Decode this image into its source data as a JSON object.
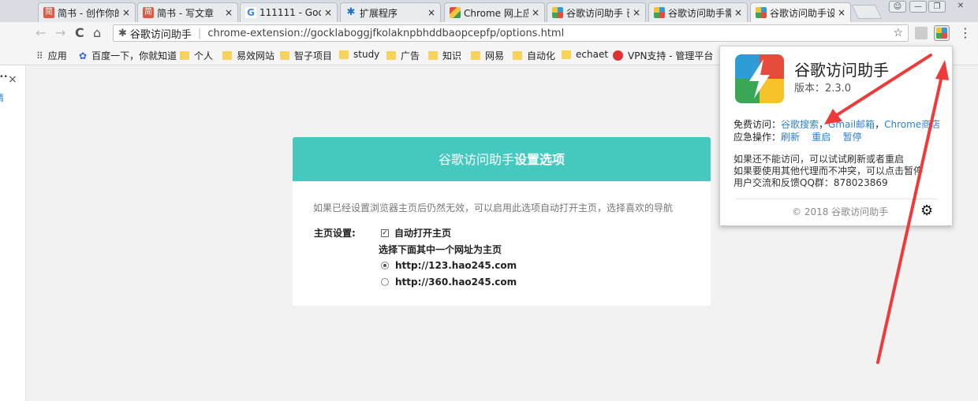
{
  "window": {
    "tabs": [
      {
        "label": "简书 - 创作你的",
        "icon": "jianshu-icon",
        "close": "×"
      },
      {
        "label": "简书 - 写文章",
        "icon": "jianshu-icon",
        "close": "×"
      },
      {
        "label": "111111 - Goog",
        "icon": "google-icon",
        "close": "×"
      },
      {
        "label": "扩展程序",
        "icon": "puzzle-icon",
        "close": "×"
      },
      {
        "label": "Chrome 网上应",
        "icon": "webstore-icon",
        "close": "×"
      },
      {
        "label": "谷歌访问助手 已",
        "icon": "helper-icon",
        "close": "×"
      },
      {
        "label": "谷歌访问助手需",
        "icon": "helper-icon",
        "close": "×"
      },
      {
        "label": "谷歌访问助手设",
        "icon": "helper-icon",
        "close": "×"
      }
    ],
    "jianshu_glyph": "简",
    "google_glyph": "G",
    "puzzle_glyph": "✱",
    "minimize": "—",
    "restore": "❐",
    "close": "✕"
  },
  "toolbar": {
    "back": "←",
    "forward": "→",
    "reload": "C",
    "home": "⌂",
    "site_name": "谷歌访问助手",
    "url": "chrome-extension://gocklaboggjfkolaknpbhddbaopcepfp/options.html",
    "star": "☆",
    "menu": "⋮"
  },
  "bookmarks": [
    {
      "label": "应用",
      "icon": "apps-grid-icon"
    },
    {
      "label": "百度一下，你就知道",
      "icon": "baidu-icon"
    },
    {
      "label": "个人",
      "icon": "folder-icon"
    },
    {
      "label": "易效网站",
      "icon": "folder-icon"
    },
    {
      "label": "智子项目",
      "icon": "folder-icon"
    },
    {
      "label": "study",
      "icon": "folder-icon"
    },
    {
      "label": "广告",
      "icon": "folder-icon"
    },
    {
      "label": "知识",
      "icon": "folder-icon"
    },
    {
      "label": "网易",
      "icon": "folder-icon"
    },
    {
      "label": "自动化",
      "icon": "folder-icon"
    },
    {
      "label": "echaet",
      "icon": "folder-icon"
    },
    {
      "label": "VPN支持 - 管理平台",
      "icon": "vpn-icon"
    }
  ],
  "sidebar": {
    "close": "×",
    "dots": "•••",
    "text": "请"
  },
  "options": {
    "title_part1": "谷歌访问助手",
    "title_part2": "设置选项",
    "description": "如果已经设置浏览器主页后仍然无效，可以启用此选项自动打开主页，选择喜欢的导航",
    "homepage_label": "主页设置:",
    "auto_open_label": "自动打开主页",
    "choose_label": "选择下面其中一个网址为主页",
    "choices": [
      "http://123.hao245.com",
      "http://360.hao245.com"
    ],
    "selected_index": 0
  },
  "popup": {
    "title": "谷歌访问助手",
    "version": "版本：2.3.0",
    "free_access_label": "免费访问：",
    "free_links": [
      "谷歌搜索",
      "Gmail邮箱",
      "Chrome商店"
    ],
    "emergency_label": "应急操作：",
    "emergency_links": [
      "刷新",
      "重启",
      "暂停"
    ],
    "help_lines": [
      "如果还不能访问，可以试试刷新或者重启",
      "如果要使用其他代理而不冲突，可以点击暂停",
      "用户交流和反馈QQ群：878023869"
    ],
    "footer": "© 2018 谷歌访问助手",
    "gear": "⚙"
  },
  "colors": {
    "header": "#45c9bf",
    "link": "#2f7fd0",
    "arrow": "#ee3a3a"
  }
}
